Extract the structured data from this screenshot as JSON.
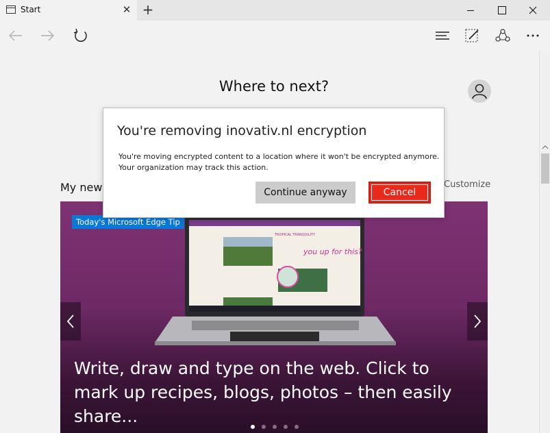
{
  "window": {
    "tab_title": "Start",
    "tab_close": "✕",
    "new_tab": "+",
    "close_glyph": "✕"
  },
  "toolbar": {
    "icons": [
      "back-icon",
      "forward-icon",
      "refresh-icon",
      "hub-icon",
      "web-note-icon",
      "share-icon",
      "more-icon"
    ]
  },
  "content": {
    "heading": "Where to next?",
    "news_label": "My new",
    "customize": "Customize",
    "hero": {
      "badge": "Today's Microsoft Edge Tip",
      "caption": "Write, draw and type on the web. Click to mark up recipes, blogs, photos – then easily share...",
      "screen_note": "you up for this?",
      "screen_heading": "TROPICAL TRANQUILITY",
      "slide_count": 5,
      "active_slide": 1
    }
  },
  "dialog": {
    "title": "You're removing inovativ.nl encryption",
    "body_line1": "You're moving encrypted content to a location where it won't be encrypted anymore.",
    "body_line2": "Your organization may track this action.",
    "continue_label": "Continue anyway",
    "cancel_label": "Cancel"
  },
  "colors": {
    "cancel_button": "#e8291c",
    "badge": "#0a78d7",
    "hero_bg": "#7a2e73"
  }
}
